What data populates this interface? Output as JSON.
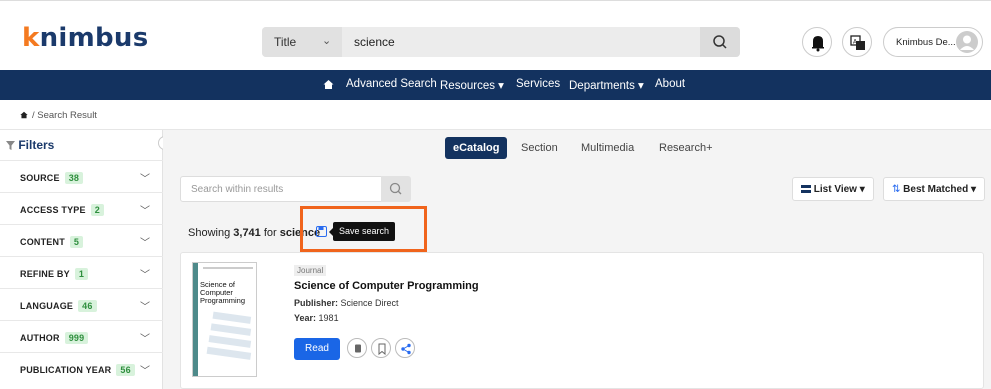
{
  "header": {
    "logo": {
      "lead": "k",
      "rest": "nimbus"
    },
    "search": {
      "type": "Title",
      "value": "science"
    },
    "user": {
      "name": "Knimbus De..."
    }
  },
  "nav": {
    "items": [
      {
        "label": "Advanced Search"
      },
      {
        "label": "Resources ▾"
      },
      {
        "label": "Services"
      },
      {
        "label": "Departments ▾"
      },
      {
        "label": "About"
      }
    ]
  },
  "breadcrumb": {
    "text": "/ Search Result"
  },
  "sidebar": {
    "title": "Filters",
    "filters": [
      {
        "label": "SOURCE",
        "count": "38"
      },
      {
        "label": "ACCESS TYPE",
        "count": "2"
      },
      {
        "label": "CONTENT",
        "count": "5"
      },
      {
        "label": "REFINE BY",
        "count": "1"
      },
      {
        "label": "LANGUAGE",
        "count": "46"
      },
      {
        "label": "AUTHOR",
        "count": "999"
      },
      {
        "label": "PUBLICATION YEAR",
        "count": "56"
      }
    ]
  },
  "tabs": [
    {
      "label": "eCatalog"
    },
    {
      "label": "Section"
    },
    {
      "label": "Multimedia"
    },
    {
      "label": "Research+"
    }
  ],
  "toolbar": {
    "within_placeholder": "Search within results",
    "view_label": "List View ▾",
    "sort_label": "Best Matched ▾"
  },
  "results": {
    "prefix": "Showing ",
    "count": "3,741",
    "middle": " for ",
    "query": "science",
    "tooltip": "Save search"
  },
  "result": {
    "cover_title": "Science of Computer Programming",
    "type": "Journal",
    "title": "Science of Computer Programming",
    "publisher_label": "Publisher:",
    "publisher": "Science Direct",
    "year_label": "Year:",
    "year": "1981",
    "read_label": "Read"
  },
  "colors": {
    "navy": "#13325f",
    "accent": "#f47a20",
    "primary_button": "#1a66e6",
    "highlight": "#f0641c"
  }
}
